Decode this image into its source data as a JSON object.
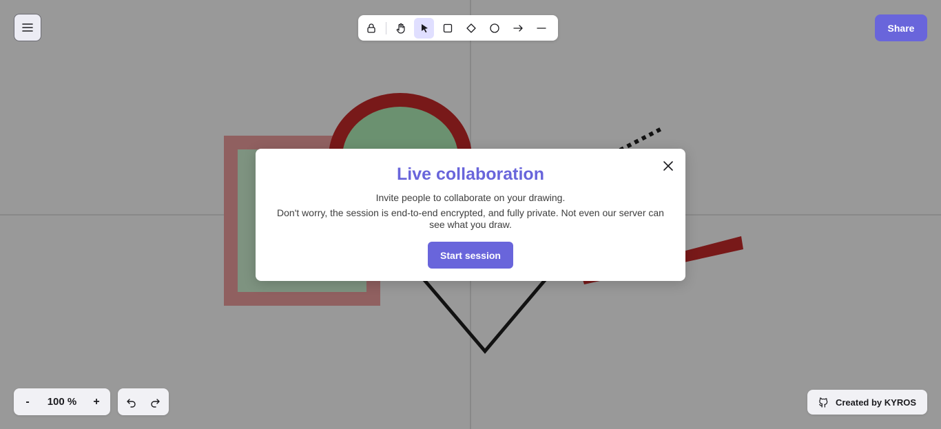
{
  "toolbar": {
    "tools": [
      {
        "icon": "lock-icon"
      },
      {
        "icon": "hand-icon"
      },
      {
        "icon": "selection-icon",
        "active": true
      },
      {
        "icon": "rectangle-icon"
      },
      {
        "icon": "diamond-icon"
      },
      {
        "icon": "ellipse-icon"
      },
      {
        "icon": "arrow-icon"
      },
      {
        "icon": "line-icon"
      }
    ]
  },
  "header": {
    "menu_icon": "hamburger-icon",
    "share_label": "Share"
  },
  "footer": {
    "zoom_out_label": "-",
    "zoom_level": "100 %",
    "zoom_in_label": "+",
    "undo_icon": "undo-icon",
    "redo_icon": "redo-icon",
    "credit_label": "Created by KYROS",
    "credit_icon": "github-icon"
  },
  "modal": {
    "title": "Live collaboration",
    "line1": "Invite people to collaborate on your drawing.",
    "line2": "Don't worry, the session is end-to-end encrypted, and fully private. Not even our server can see what you draw.",
    "start_label": "Start session",
    "close_icon": "close-icon"
  },
  "colors": {
    "accent": "#6965db",
    "overlay": "rgba(0,0,0,0.4)",
    "shape_red": "#c92a2a",
    "shape_green": "#b2f2bb",
    "shape_pink": "#ffc9c9",
    "stroke_black": "#1e1e1e"
  }
}
